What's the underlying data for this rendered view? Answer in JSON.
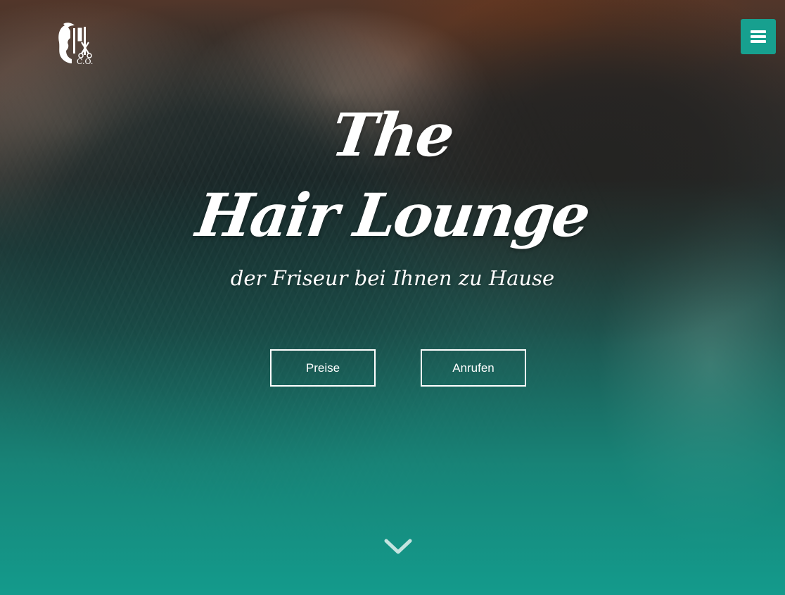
{
  "header": {
    "logo_icon": "barber-co-logo",
    "menu_icon": "hamburger-menu-icon"
  },
  "hero": {
    "title_line1": "The",
    "title_line2": "Hair Lounge",
    "subtitle": "der Friseur bei Ihnen zu Hause",
    "buttons": [
      {
        "label": "Preise"
      },
      {
        "label": "Anrufen"
      }
    ],
    "scroll_icon": "chevron-down-icon"
  },
  "colors": {
    "accent": "#17a08f",
    "text": "#ffffff"
  }
}
